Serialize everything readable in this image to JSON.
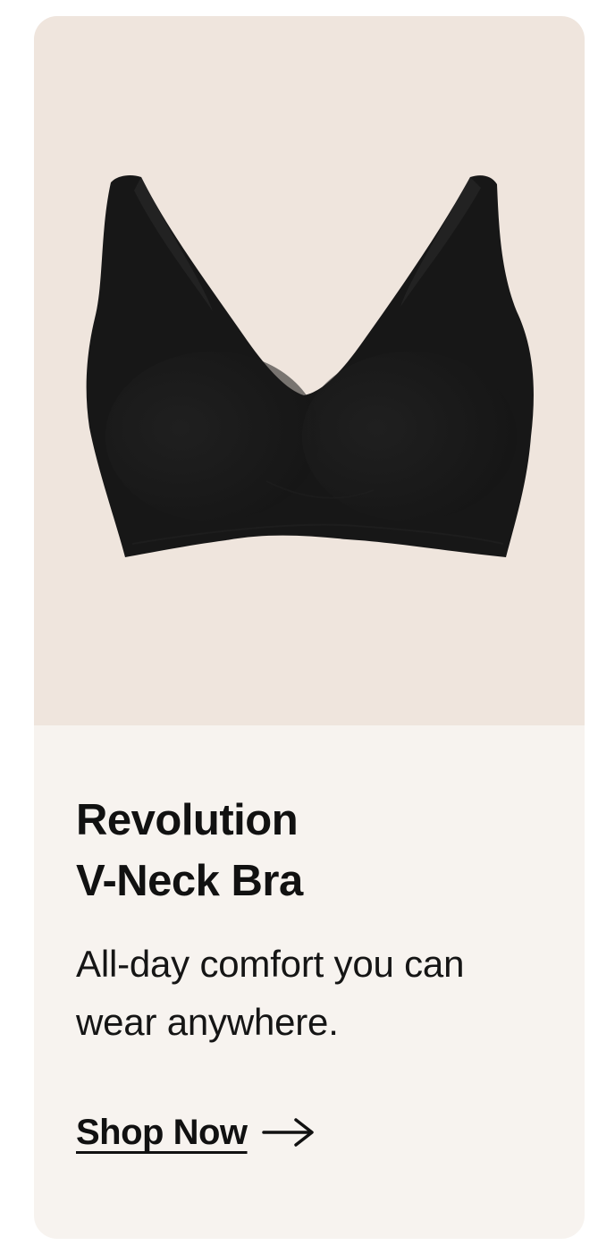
{
  "card": {
    "title_line1": "Revolution",
    "title_line2": "V-Neck Bra",
    "description_line1": "All-day comfort you can",
    "description_line2": "wear anywhere.",
    "cta_label": "Shop Now",
    "cta_icon": "arrow-right-icon",
    "product_image": "black-v-neck-bra",
    "colors": {
      "image_background": "#efe5dd",
      "content_background": "#f7f3ef",
      "product": "#181818",
      "text": "#111111"
    }
  }
}
